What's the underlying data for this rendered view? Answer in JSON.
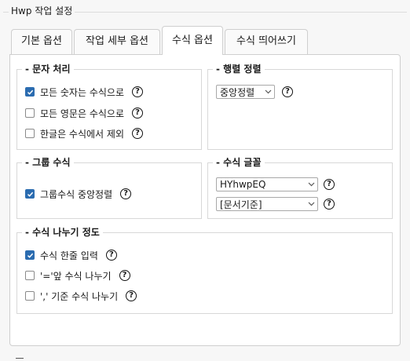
{
  "dialog": {
    "title": "Hwp 작업 설정"
  },
  "tabs": [
    {
      "label": "기본 옵션",
      "active": false
    },
    {
      "label": "작업 세부 옵션",
      "active": false
    },
    {
      "label": "수식 옵션",
      "active": true
    },
    {
      "label": "수식 띄어쓰기",
      "active": false
    }
  ],
  "char_processing": {
    "title": "문자 처리",
    "options": [
      {
        "label": "모든 숫자는 수식으로",
        "checked": true
      },
      {
        "label": "모든 영문은 수식으로",
        "checked": false
      },
      {
        "label": "한글은 수식에서 제외",
        "checked": false
      }
    ]
  },
  "matrix_align": {
    "title": "행렬 정렬",
    "selected": "중앙정렬"
  },
  "group_formula": {
    "title": "그룹 수식",
    "options": [
      {
        "label": "그룹수식 중앙정렬",
        "checked": true
      }
    ]
  },
  "formula_font": {
    "title": "수식 글꼴",
    "font": "HYhwpEQ",
    "base": "[문서기준]"
  },
  "split_level": {
    "title": "수식 나누기 정도",
    "options": [
      {
        "label": "수식 한줄 입력",
        "checked": true
      },
      {
        "label": "'='앞 수식 나누기",
        "checked": false
      },
      {
        "label": "',' 기준 수식 나누기",
        "checked": false
      }
    ]
  },
  "icons": {
    "help": "question-circle-icon",
    "dropdown": "chevron-down-icon",
    "check": "checkmark-icon"
  },
  "colors": {
    "checked": "#2b6cb0"
  }
}
